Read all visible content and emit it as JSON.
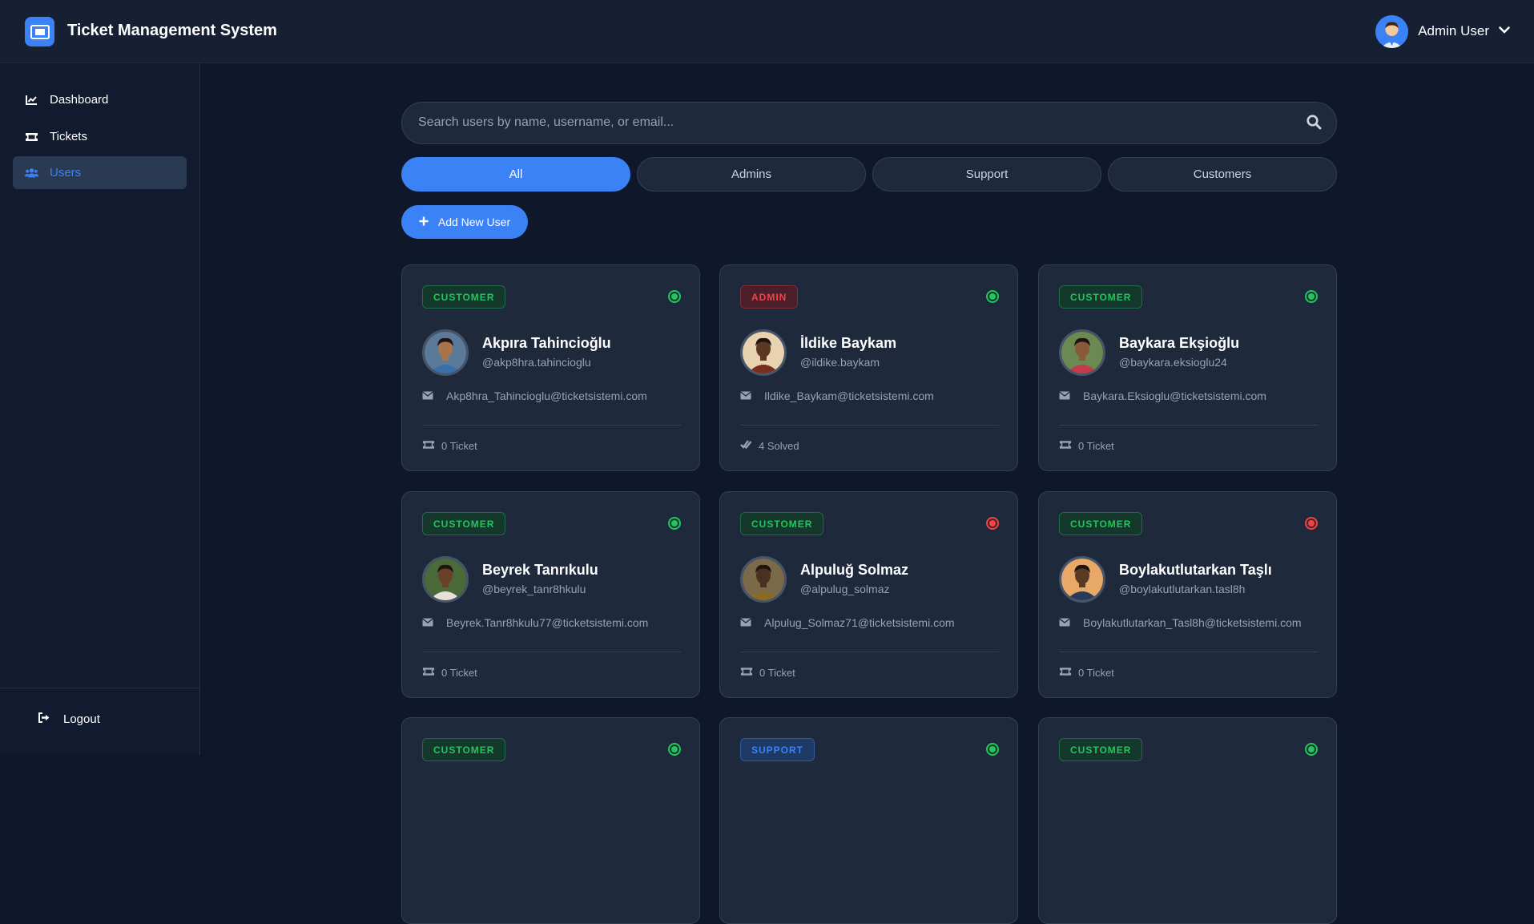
{
  "header": {
    "app_title": "Ticket Management System",
    "user_name": "Admin User"
  },
  "sidebar": {
    "items": [
      {
        "label": "Dashboard",
        "icon": "chart-line-icon"
      },
      {
        "label": "Tickets",
        "icon": "ticket-icon"
      },
      {
        "label": "Users",
        "icon": "users-icon",
        "active": true
      }
    ],
    "logout_label": "Logout"
  },
  "search": {
    "placeholder": "Search users by name, username, or email..."
  },
  "filters": [
    {
      "label": "All",
      "active": true
    },
    {
      "label": "Admins"
    },
    {
      "label": "Support"
    },
    {
      "label": "Customers"
    }
  ],
  "add_user_label": "Add New User",
  "colors": {
    "accent": "#3b82f6",
    "online": "#22c55e",
    "offline": "#ef4444",
    "background": "#0f172a",
    "card": "#1e293b"
  },
  "users": [
    {
      "role": "CUSTOMER",
      "role_type": "customer",
      "status": "online",
      "name": "Akpıra Tahincioğlu",
      "username": "@akp8hra.tahincioglu",
      "email": "Akp8hra_Tahincioglu@ticketsistemi.com",
      "footer_icon": "ticket-icon",
      "footer": "0 Ticket",
      "avatar_skin": "#a8754a",
      "avatar_bg": "#5b7a9a",
      "avatar_shirt": "#3a6fa8"
    },
    {
      "role": "ADMIN",
      "role_type": "admin",
      "status": "online",
      "name": "İldike Baykam",
      "username": "@ildike.baykam",
      "email": "Ildike_Baykam@ticketsistemi.com",
      "footer_icon": "check-double-icon",
      "footer": "4 Solved",
      "avatar_skin": "#5a3824",
      "avatar_bg": "#e8d2b0",
      "avatar_shirt": "#7a2e1e"
    },
    {
      "role": "CUSTOMER",
      "role_type": "customer",
      "status": "online",
      "name": "Baykara Ekşioğlu",
      "username": "@baykara.eksioglu24",
      "email": "Baykara.Eksioglu@ticketsistemi.com",
      "footer_icon": "ticket-icon",
      "footer": "0 Ticket",
      "avatar_skin": "#8a5a38",
      "avatar_bg": "#6a8a52",
      "avatar_shirt": "#c43a4a"
    },
    {
      "role": "CUSTOMER",
      "role_type": "customer",
      "status": "online",
      "name": "Beyrek Tanrıkulu",
      "username": "@beyrek_tanr8hkulu",
      "email": "Beyrek.Tanr8hkulu77@ticketsistemi.com",
      "footer_icon": "ticket-icon",
      "footer": "0 Ticket",
      "avatar_skin": "#6a4028",
      "avatar_bg": "#4a6a3a",
      "avatar_shirt": "#e8e0d8"
    },
    {
      "role": "CUSTOMER",
      "role_type": "customer",
      "status": "offline",
      "name": "Alpuluğ Solmaz",
      "username": "@alpulug_solmaz",
      "email": "Alpulug_Solmaz71@ticketsistemi.com",
      "footer_icon": "ticket-icon",
      "footer": "0 Ticket",
      "avatar_skin": "#4a3020",
      "avatar_bg": "#7a6a4a",
      "avatar_shirt": "#8a6a28"
    },
    {
      "role": "CUSTOMER",
      "role_type": "customer",
      "status": "offline",
      "name": "Boylakutlutarkan Taşlı",
      "username": "@boylakutlutarkan.tasl8h",
      "email": "Boylakutlutarkan_Tasl8h@ticketsistemi.com",
      "footer_icon": "ticket-icon",
      "footer": "0 Ticket",
      "avatar_skin": "#5a3a24",
      "avatar_bg": "#e8a868",
      "avatar_shirt": "#2a3a5a"
    },
    {
      "role": "CUSTOMER",
      "role_type": "customer",
      "status": "online",
      "name": "",
      "username": "",
      "email": "",
      "footer_icon": "",
      "footer": "",
      "avatar_skin": "",
      "avatar_bg": "",
      "avatar_shirt": ""
    },
    {
      "role": "SUPPORT",
      "role_type": "support",
      "status": "online",
      "name": "",
      "username": "",
      "email": "",
      "footer_icon": "",
      "footer": "",
      "avatar_skin": "",
      "avatar_bg": "",
      "avatar_shirt": ""
    },
    {
      "role": "CUSTOMER",
      "role_type": "customer",
      "status": "online",
      "name": "",
      "username": "",
      "email": "",
      "footer_icon": "",
      "footer": "",
      "avatar_skin": "",
      "avatar_bg": "",
      "avatar_shirt": ""
    }
  ]
}
